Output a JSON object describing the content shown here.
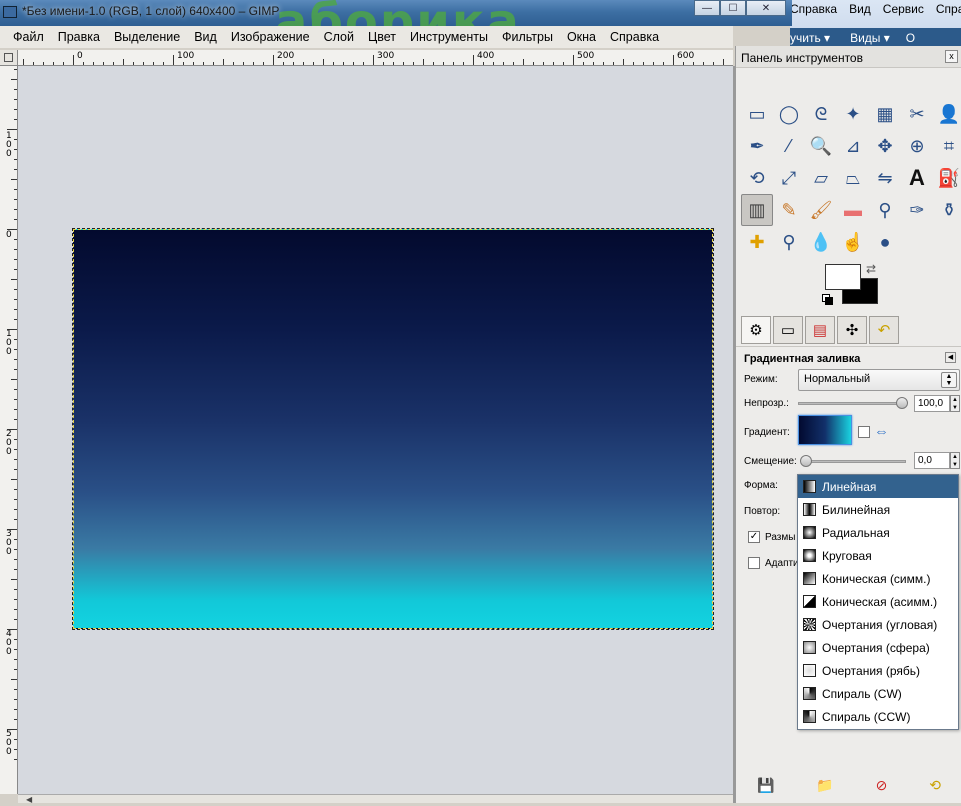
{
  "background_app": {
    "menu": [
      "Справка",
      "Вид",
      "Сервис",
      "Справ"
    ],
    "toolbar": [
      "учить ▾",
      "Виды ▾",
      "О"
    ]
  },
  "window": {
    "title": "*Без имени-1.0 (RGB, 1 слой) 640x400 – GIMP",
    "watermark": "аборика",
    "buttons": {
      "minimize": "—",
      "maximize": "☐",
      "close": "✕"
    }
  },
  "menu": [
    {
      "label": "Файл"
    },
    {
      "label": "Правка"
    },
    {
      "label": "Выделение"
    },
    {
      "label": "Вид"
    },
    {
      "label": "Изображение"
    },
    {
      "label": "Слой"
    },
    {
      "label": "Цвет"
    },
    {
      "label": "Инструменты"
    },
    {
      "label": "Фильтры"
    },
    {
      "label": "Окна"
    },
    {
      "label": "Справка"
    }
  ],
  "ruler": {
    "top_labels": [
      "0",
      "100",
      "200",
      "300",
      "400",
      "500",
      "600"
    ],
    "left_labels": [
      "100",
      "0",
      "100",
      "200",
      "300",
      "400",
      "500"
    ]
  },
  "image": {
    "width": 640,
    "height": 400,
    "gradient_colors": [
      "#030a2e",
      "#1a3268",
      "#13d3e1"
    ]
  },
  "toolbox": {
    "title": "Панель инструментов",
    "close": "x",
    "tools": [
      "rect-select-icon",
      "ellipse-select-icon",
      "lasso-icon",
      "fuzzy-select-icon",
      "color-select-icon",
      "scissors-icon",
      "foreground-select-icon",
      "paths-icon",
      "color-picker-icon",
      "zoom-icon",
      "measure-icon",
      "move-icon",
      "align-icon",
      "crop-icon",
      "rotate-icon",
      "scale-icon",
      "shear-icon",
      "perspective-icon",
      "flip-icon",
      "text-icon",
      "bucket-fill-icon",
      "blend-icon",
      "pencil-icon",
      "paintbrush-icon",
      "eraser-icon",
      "airbrush-icon",
      "ink-icon",
      "clone-icon",
      "heal-icon",
      "perspective-clone-icon",
      "blur-icon",
      "smudge-icon",
      "dodge-burn-icon"
    ],
    "active_tool": "blend-icon",
    "fg_color": "#ffffff",
    "bg_color": "#000000"
  },
  "options": {
    "header": "Градиентная заливка",
    "mode_label": "Режим:",
    "mode_value": "Нормальный",
    "opacity_label": "Непрозр.:",
    "opacity_value": "100,0",
    "opacity_fraction": 1.0,
    "gradient_label": "Градиент:",
    "offset_label": "Смещение:",
    "offset_value": "0,0",
    "offset_fraction": 0.0,
    "shape_label": "Форма:",
    "repeat_label": "Повтор:",
    "dither_label": "Размы",
    "adaptive_label": "Адапти"
  },
  "shape_popup": {
    "selected": 0,
    "items": [
      {
        "label": "Линейная",
        "icon": "linear-icon"
      },
      {
        "label": "Билинейная",
        "icon": "bilinear-icon"
      },
      {
        "label": "Радиальная",
        "icon": "radial-icon"
      },
      {
        "label": "Круговая",
        "icon": "square-icon"
      },
      {
        "label": "Коническая (симм.)",
        "icon": "conical-sym-icon"
      },
      {
        "label": "Коническая (асимм.)",
        "icon": "conical-asym-icon"
      },
      {
        "label": "Очертания (угловая)",
        "icon": "shaped-angular-icon"
      },
      {
        "label": "Очертания (сфера)",
        "icon": "shaped-spherical-icon"
      },
      {
        "label": "Очертания (рябь)",
        "icon": "shaped-dimpled-icon"
      },
      {
        "label": "Спираль (CW)",
        "icon": "spiral-cw-icon"
      },
      {
        "label": "Спираль (CCW)",
        "icon": "spiral-ccw-icon"
      }
    ]
  }
}
